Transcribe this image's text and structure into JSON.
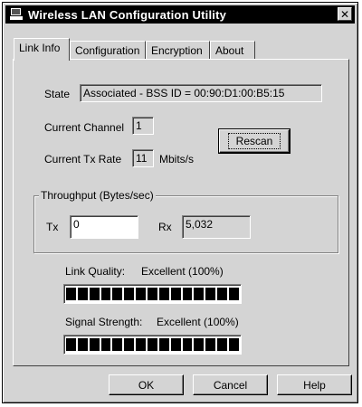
{
  "window": {
    "title": "Wireless LAN Configuration Utility",
    "close_glyph": "✕"
  },
  "tabs": [
    {
      "label": "Link Info",
      "active": true
    },
    {
      "label": "Configuration",
      "active": false
    },
    {
      "label": "Encryption",
      "active": false
    },
    {
      "label": "About",
      "active": false
    }
  ],
  "link_info": {
    "state_label": "State",
    "state_value": "Associated - BSS ID = 00:90:D1:00:B5:15",
    "channel_label": "Current Channel",
    "channel_value": "1",
    "tx_rate_label": "Current Tx Rate",
    "tx_rate_value": "11",
    "tx_rate_unit": "Mbits/s",
    "rescan_label": "Rescan"
  },
  "throughput": {
    "title": "Throughput (Bytes/sec)",
    "tx_label": "Tx",
    "tx_value": "0",
    "rx_label": "Rx",
    "rx_value": "5,032"
  },
  "link_quality": {
    "label": "Link Quality:",
    "value": "Excellent (100%)",
    "level": 1.0
  },
  "signal_strength": {
    "label": "Signal Strength:",
    "value": "Excellent (100%)",
    "level": 1.0
  },
  "buttons": {
    "ok": "OK",
    "cancel": "Cancel",
    "help": "Help"
  }
}
